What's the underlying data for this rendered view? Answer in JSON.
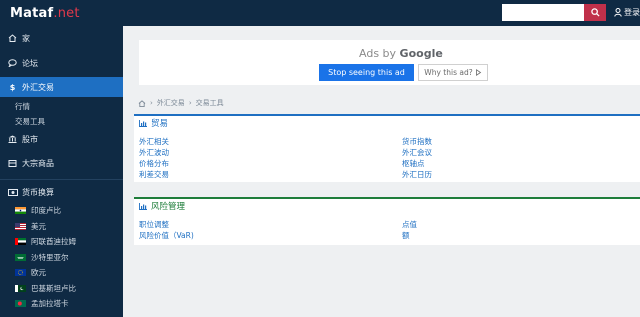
{
  "header": {
    "logo_main": "Mataf",
    "logo_dot": ".net",
    "search_placeholder": "",
    "login_label": "登录"
  },
  "sidebar": {
    "nav": [
      {
        "label": "家",
        "icon": "home-icon"
      },
      {
        "label": "论坛",
        "icon": "chat-icon"
      },
      {
        "label": "外汇交易",
        "icon": "dollar-icon",
        "active": true
      }
    ],
    "forex_sub": [
      "行情",
      "交易工具"
    ],
    "nav2": [
      {
        "label": "股市",
        "icon": "bank-icon"
      },
      {
        "label": "大宗商品",
        "icon": "crate-icon"
      }
    ],
    "converter_label": "货币换算",
    "currencies": [
      {
        "label": "印度卢比",
        "flag": "india-flag-icon"
      },
      {
        "label": "美元",
        "flag": "usa-flag-icon"
      },
      {
        "label": "阿联酋迪拉姆",
        "flag": "uae-flag-icon"
      },
      {
        "label": "沙特里亚尔",
        "flag": "saudi-flag-icon"
      },
      {
        "label": "欧元",
        "flag": "eu-flag-icon"
      },
      {
        "label": "巴基斯坦卢比",
        "flag": "pakistan-flag-icon"
      },
      {
        "label": "孟加拉塔卡",
        "flag": "bangladesh-flag-icon"
      }
    ]
  },
  "ad": {
    "ads_by": "Ads by",
    "google": "Google",
    "stop_label": "Stop seeing this ad",
    "why_label": "Why this ad?"
  },
  "breadcrumb": [
    "外汇交易",
    "交易工具"
  ],
  "panels": {
    "trading": {
      "title": "贸易",
      "left": [
        "外汇相关",
        "外汇波动",
        "价格分布",
        "利差交易"
      ],
      "right": [
        "货币指数",
        "外汇会议",
        "枢轴点",
        "外汇日历"
      ]
    },
    "risk": {
      "title": "风险管理",
      "left": [
        "职位调整",
        "风险价值（VaR)"
      ],
      "right": [
        "点值",
        "额"
      ]
    }
  },
  "colors": {
    "navy": "#0f2a44",
    "accent_blue": "#1e6fc2",
    "accent_green": "#1e7d3a",
    "brand_red": "#e2394b"
  }
}
